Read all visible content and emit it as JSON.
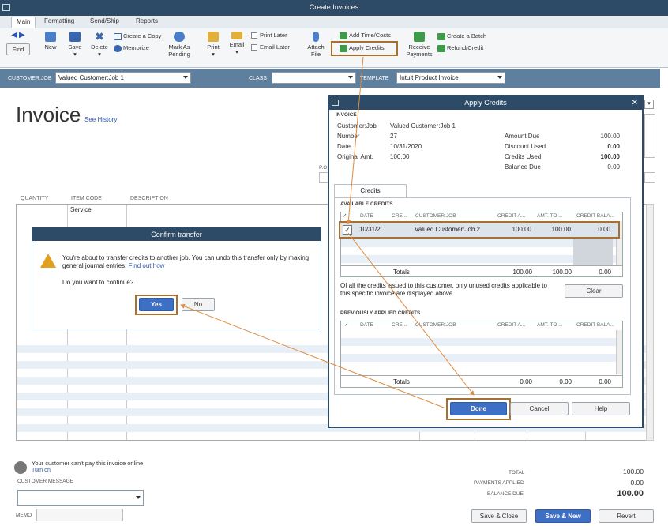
{
  "window": {
    "title": "Create Invoices"
  },
  "tabs": [
    "Main",
    "Formatting",
    "Send/Ship",
    "Reports"
  ],
  "ribbon": {
    "find": "Find",
    "new": "New",
    "save": "Save",
    "delete": "Delete",
    "create_copy": "Create a Copy",
    "memorize": "Memorize",
    "mark_as_pending": [
      "Mark As",
      "Pending"
    ],
    "print": "Print",
    "email": "Email",
    "print_later": "Print Later",
    "email_later": "Email Later",
    "attach_file": [
      "Attach",
      "File"
    ],
    "add_time_costs": "Add Time/Costs",
    "apply_credits": "Apply Credits",
    "receive_payments": [
      "Receive",
      "Payments"
    ],
    "create_batch": "Create a Batch",
    "refund_credit": "Refund/Credit"
  },
  "customer_bar": {
    "customer_job_label": "CUSTOMER:JOB",
    "customer_job_value": "Valued Customer:Job 1",
    "class_label": "CLASS",
    "class_value": "",
    "template_label": "TEMPLATE",
    "template_value": "Intuit Product Invoice"
  },
  "form": {
    "title": "Invoice",
    "see_history": "See History",
    "po_label": "P.O",
    "columns": [
      "QUANTITY",
      "ITEM CODE",
      "DESCRIPTION"
    ],
    "first_item": "Service",
    "online_msg": "Your customer can't pay this invoice online",
    "turn_on": "Turn on",
    "customer_message_label": "CUSTOMER MESSAGE",
    "memo_label": "MEMO",
    "total_label": "TOTAL",
    "total_value": "100.00",
    "payments_applied_label": "PAYMENTS APPLIED",
    "payments_applied_value": "0.00",
    "balance_due_label": "BALANCE DUE",
    "balance_due_value": "100.00"
  },
  "footer_buttons": {
    "save_close": "Save & Close",
    "save_new": "Save & New",
    "revert": "Revert"
  },
  "confirm": {
    "title": "Confirm transfer",
    "message": "You're about to transfer credits to another job. You can undo this transfer only by making general journal entries.",
    "find_out_how": "Find out how",
    "question": "Do you want to continue?",
    "yes": "Yes",
    "no": "No"
  },
  "apply_credits": {
    "title": "Apply Credits",
    "invoice_section": "INVOICE",
    "customer_job_label": "Customer:Job",
    "customer_job": "Valued Customer:Job 1",
    "number_label": "Number",
    "number": "27",
    "date_label": "Date",
    "date": "10/31/2020",
    "original_amt_label": "Original Amt.",
    "original_amt": "100.00",
    "amount_due_label": "Amount Due",
    "amount_due": "100.00",
    "discount_used_label": "Discount Used",
    "discount_used": "0.00",
    "credits_used_label": "Credits Used",
    "credits_used": "100.00",
    "balance_due_label": "Balance Due",
    "balance_due": "0.00",
    "tab": "Credits",
    "available_title": "AVAILABLE CREDITS",
    "previous_title": "PREVIOUSLY APPLIED CREDITS",
    "headers": [
      "DATE",
      "CRE...",
      "CUSTOMER:JOB",
      "CREDIT A...",
      "AMT. TO ...",
      "CREDIT BALA..."
    ],
    "available_row": {
      "date": "10/31/2...",
      "credit_no": "",
      "customer_job": "Valued Customer:Job 2",
      "credit_amt": "100.00",
      "amt_to_use": "100.00",
      "credit_balance": "0.00"
    },
    "available_totals": {
      "label": "Totals",
      "credit_amt": "100.00",
      "amt_to_use": "100.00",
      "credit_balance": "0.00"
    },
    "note": "Of all the credits issued to this customer, only unused credits applicable to this specific invoice are displayed above.",
    "clear": "Clear",
    "previous_totals": {
      "label": "Totals",
      "credit_amt": "0.00",
      "amt_to_use": "0.00",
      "credit_balance": "0.00"
    },
    "done": "Done",
    "cancel": "Cancel",
    "help": "Help"
  },
  "colors": {
    "title_bar": "#2d4a66",
    "customer_bar": "#5f7f9f",
    "highlight": "#a96f2d",
    "accent_blue": "#3d6fc4",
    "arrow": "#e08a3c"
  }
}
